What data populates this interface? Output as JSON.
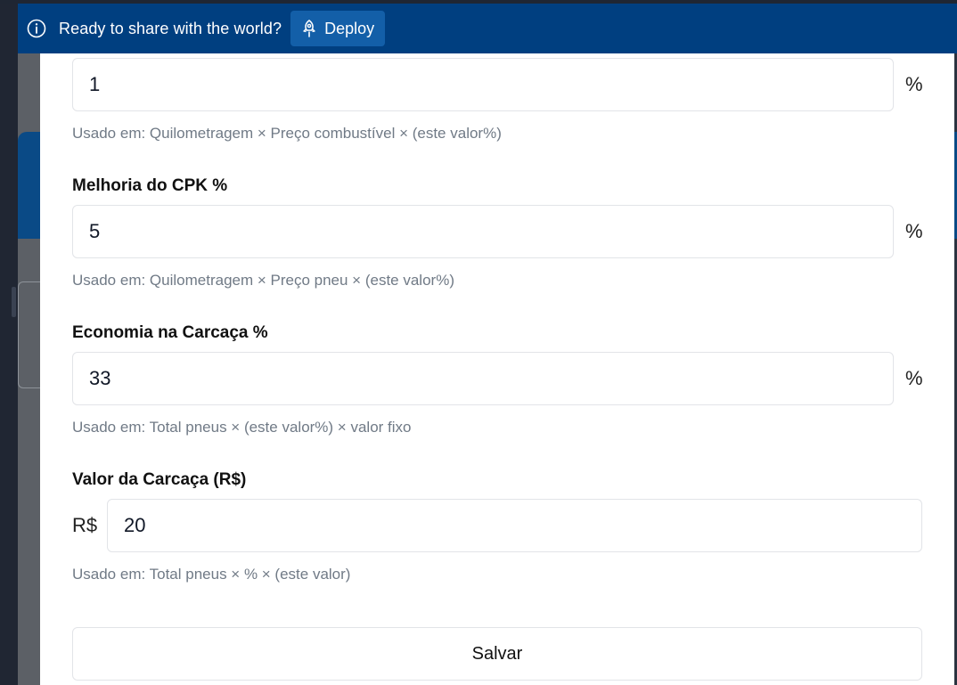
{
  "banner": {
    "message": "Ready to share with the world?",
    "deploy_label": "Deploy",
    "icons": {
      "info": "info-circle-icon",
      "deploy": "rocket-icon"
    },
    "colors": {
      "background": "#003f80",
      "button": "#135fa8"
    }
  },
  "form": {
    "fields": [
      {
        "label": "",
        "value": "1",
        "unit": "%",
        "help": "Usado em: Quilometragem × Preço combustível × (este valor%)"
      },
      {
        "label": "Melhoria do CPK %",
        "value": "5",
        "unit": "%",
        "help": "Usado em: Quilometragem × Preço pneu × (este valor%)"
      },
      {
        "label": "Economia na Carcaça %",
        "value": "33",
        "unit": "%",
        "help": "Usado em: Total pneus × (este valor%) × valor fixo"
      },
      {
        "label": "Valor da Carcaça (R$)",
        "value": "20",
        "prefix": "R$",
        "help": "Usado em: Total pneus × % × (este valor)"
      }
    ],
    "save_label": "Salvar"
  }
}
